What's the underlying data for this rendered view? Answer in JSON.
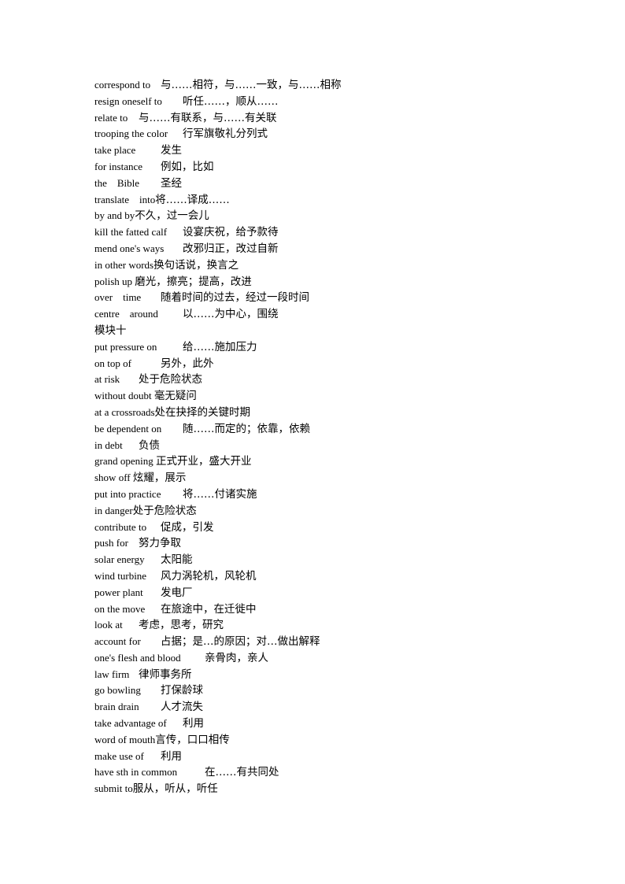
{
  "entries": [
    {
      "en": "correspond to",
      "zh": "与……相符，与……一致，与……相称"
    },
    {
      "en": "resign oneself to",
      "zh": "听任……，顺从……"
    },
    {
      "en": "relate to",
      "zh": "与……有联系，与……有关联"
    },
    {
      "en": "trooping the color",
      "zh": "行军旗敬礼分列式"
    },
    {
      "en": "take place",
      "zh": "发生"
    },
    {
      "en": "for instance",
      "zh": "例如，比如"
    },
    {
      "en": "the    Bible",
      "zh": "圣经"
    },
    {
      "en": "translate    into",
      "zh": "将……译成……"
    },
    {
      "en": "by and by",
      "zh": "不久，过一会儿"
    },
    {
      "en": "kill the fatted calf",
      "zh": "设宴庆祝，给予款待"
    },
    {
      "en": "mend one's ways",
      "zh": "改邪归正，改过自新"
    },
    {
      "en": "in other words",
      "zh": "换句话说，换言之"
    },
    {
      "en": "polish up",
      "zh": "磨光，擦亮；提高，改进"
    },
    {
      "en": "over    time",
      "zh": "随着时间的过去，经过一段时间"
    },
    {
      "en": "centre    around",
      "zh": "以……为中心，围绕"
    }
  ],
  "section_heading": "模块十",
  "entries2": [
    {
      "en": "put pressure on",
      "zh": "给……施加压力"
    },
    {
      "en": "on top of",
      "zh": "另外，此外"
    },
    {
      "en": "at risk",
      "zh": "处于危险状态"
    },
    {
      "en": "without doubt",
      "zh": "毫无疑问"
    },
    {
      "en": "at a crossroads",
      "zh": "处在抉择的关键时期"
    },
    {
      "en": "be dependent on",
      "zh": "随……而定的；依靠，依赖"
    },
    {
      "en": "in debt",
      "zh": "负债"
    },
    {
      "en": "grand opening",
      "zh": "正式开业，盛大开业"
    },
    {
      "en": "show off",
      "zh": "炫耀，展示"
    },
    {
      "en": "put into practice",
      "zh": "将……付诸实施"
    },
    {
      "en": "in danger",
      "zh": "处于危险状态"
    },
    {
      "en": "contribute to",
      "zh": "促成，引发"
    },
    {
      "en": "push for",
      "zh": "努力争取"
    },
    {
      "en": "solar energy",
      "zh": "太阳能"
    },
    {
      "en": "wind turbine",
      "zh": "风力涡轮机，风轮机"
    },
    {
      "en": "power plant",
      "zh": "发电厂"
    },
    {
      "en": "on the move",
      "zh": "在旅途中，在迁徙中"
    },
    {
      "en": "look at",
      "zh": "考虑，思考，研究"
    },
    {
      "en": "account for",
      "zh": "占据；是…的原因；对…做出解释"
    },
    {
      "en": "one's flesh and blood",
      "zh": "亲骨肉，亲人"
    },
    {
      "en": "law firm",
      "zh": "律师事务所"
    },
    {
      "en": "go bowling",
      "zh": "打保龄球"
    },
    {
      "en": "brain drain",
      "zh": "人才流失"
    },
    {
      "en": "take advantage of",
      "zh": "利用"
    },
    {
      "en": "word of mouth",
      "zh": "言传，口口相传"
    },
    {
      "en": "make use of",
      "zh": "利用"
    },
    {
      "en": "have sth in common",
      "zh": "在……有共同处"
    },
    {
      "en": "submit to",
      "zh": "服从，听从，听任"
    }
  ]
}
